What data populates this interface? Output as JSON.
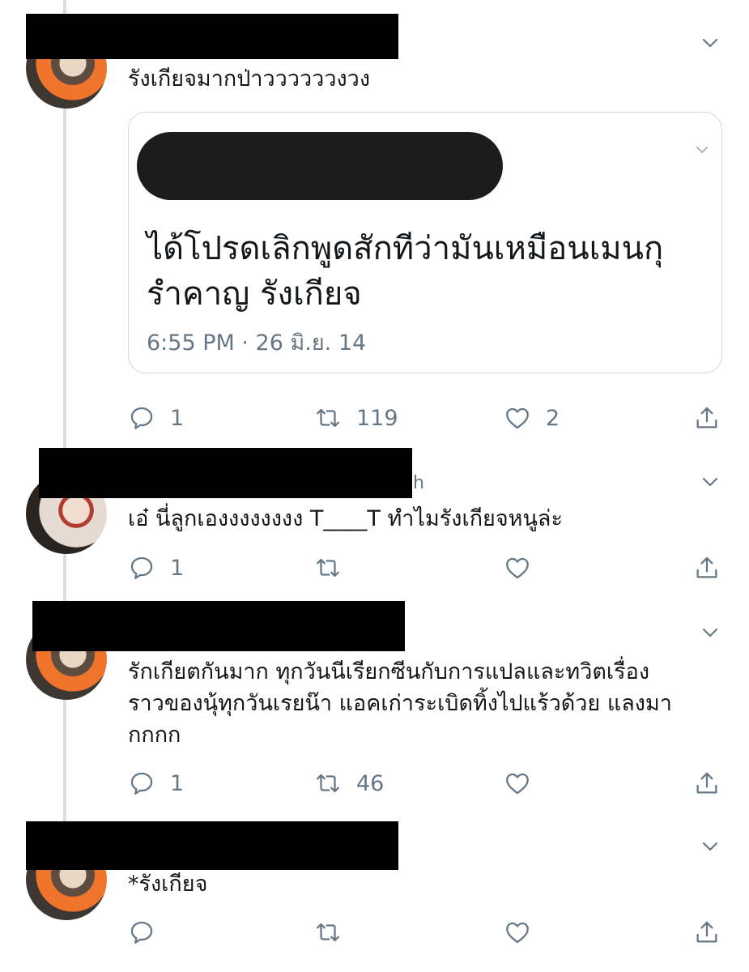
{
  "thread": [
    {
      "avatar": "orange-shirt-avatar",
      "text_lines": [
        "รังเกียจมากป่าววววววงวง"
      ],
      "quote": {
        "text_lines": [
          "ได้โปรดเลิกพูดสักทีว่ามันเหมือนเมนกุ",
          "รำคาญ รังเกียจ"
        ],
        "timestamp": "6:55 PM · 26 มิ.ย. 14"
      },
      "reply_count": "1",
      "retweet_count": "119",
      "like_count": "2"
    },
    {
      "avatar": "light-avatar",
      "header_fragment": "h",
      "text_lines": [
        "เอ๋ นี่ลูกเองงงงงงงง T____T ทำไมรังเกียจหนูล่ะ"
      ],
      "reply_count": "1",
      "retweet_count": "",
      "like_count": ""
    },
    {
      "avatar": "orange-shirt-avatar",
      "text_lines": [
        "รักเกียตกันมาก ทุกวันนีเรียกซีนกับการแปลและทวิตเรื่อง",
        "ราวของนุ้ทุกวันเรยน๊า แอคเก่าระเบิดทิ้งไปแร้วด้วย แลงมา",
        "กกกก"
      ],
      "reply_count": "1",
      "retweet_count": "46",
      "like_count": ""
    },
    {
      "avatar": "orange-shirt-avatar",
      "text_lines": [
        "*รังเกียจ"
      ],
      "reply_count": "",
      "retweet_count": "",
      "like_count": ""
    }
  ],
  "icons": {
    "reply": "speech-bubble-icon",
    "retweet": "retweet-arrows-icon",
    "like": "heart-icon",
    "share": "share-upload-icon",
    "menu": "chevron-down-icon"
  },
  "colors": {
    "text": "#14171a",
    "secondary": "#657786",
    "border": "#ccd6dd",
    "thread_line": "#d7dde2"
  }
}
